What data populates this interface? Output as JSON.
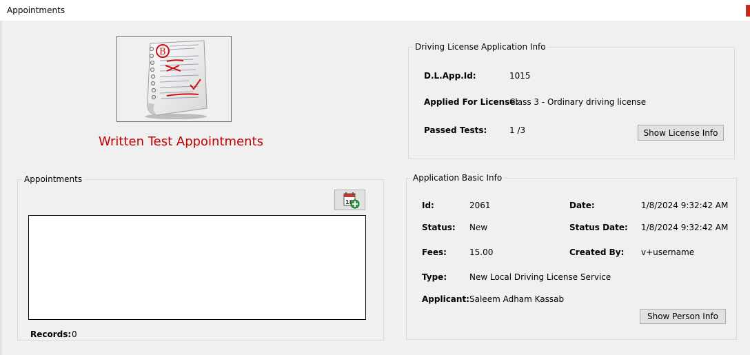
{
  "window": {
    "title": "Appointments"
  },
  "header": {
    "heading": "Written Test Appointments"
  },
  "dl_app_info": {
    "group_title": "Driving License Application Info",
    "dl_app_id_label": "D.L.App.Id:",
    "dl_app_id_value": "1015",
    "applied_for_label": "Applied For License:",
    "applied_for_value": "Class 3 - Ordinary driving license",
    "passed_tests_label": "Passed Tests:",
    "passed_tests_value": "1 /3",
    "show_license_button": "Show License Info"
  },
  "appointments": {
    "group_title": "Appointments",
    "records_label": "Records:",
    "records_value": "0",
    "add_icon": "calendar-add-icon"
  },
  "basic_info": {
    "group_title": "Application Basic Info",
    "id_label": "Id:",
    "id_value": "2061",
    "date_label": "Date:",
    "date_value": "1/8/2024 9:32:42 AM",
    "status_label": "Status:",
    "status_value": "New",
    "status_date_label": "Status Date:",
    "status_date_value": "1/8/2024 9:32:42 AM",
    "fees_label": "Fees:",
    "fees_value": "15.00",
    "created_by_label": "Created By:",
    "created_by_value": "v+username",
    "type_label": "Type:",
    "type_value": "New Local Driving License Service",
    "applicant_label": "Applicant:",
    "applicant_value": "Saleem Adham Kassab",
    "show_person_button": "Show Person Info"
  },
  "colors": {
    "heading": "#c00000",
    "close_accent": "#c42b1c"
  }
}
